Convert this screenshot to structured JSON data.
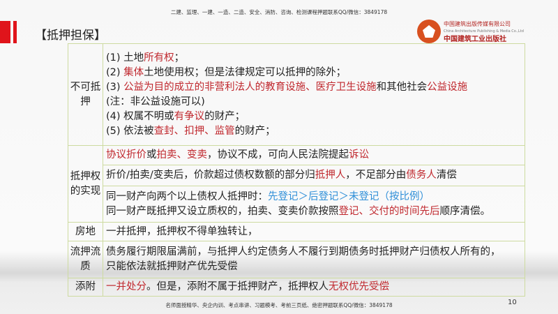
{
  "header_banner": "二建、监理、一建、一造、二造、安全、消防、咨询、检测课程押题联系QQ/微信：3849178",
  "title": "【抵押担保】",
  "logo": {
    "cn": "中国建筑出版传媒有限公司",
    "en": "China Architecture Publishing & Media Co.,Ltd",
    "cal": "中国建筑工业出版社"
  },
  "colors": {
    "red": "#c0282e",
    "blue": "#2f8fd8",
    "accent": "#e0141b"
  },
  "rows": [
    {
      "label": "不可抵押",
      "cells": [
        [
          [
            {
              "t": "(1) 土地"
            },
            {
              "t": "所有权",
              "c": "r"
            },
            {
              "t": "；"
            }
          ],
          [
            {
              "t": "(2) "
            },
            {
              "t": "集体",
              "c": "r"
            },
            {
              "t": "土地使用权；但是法律规定可以抵押的除外；"
            }
          ],
          [
            {
              "t": "(3) "
            },
            {
              "t": "公益为目的成立的非营利法人的教育设施、医疗卫生设施",
              "c": "r"
            },
            {
              "t": "和其他社会"
            },
            {
              "t": "公益设施",
              "c": "r"
            }
          ],
          [
            {
              "t": "(注：非公益设施可以)"
            }
          ],
          [
            {
              "t": "(4) 权属不明或"
            },
            {
              "t": "有争议",
              "c": "r"
            },
            {
              "t": "的财产；"
            }
          ],
          [
            {
              "t": "(5) 依法被"
            },
            {
              "t": "查封、扣押、监管",
              "c": "r"
            },
            {
              "t": "的财产；"
            }
          ]
        ]
      ]
    },
    {
      "label": "抵押权的实现",
      "cells": [
        [
          [
            {
              "t": "协议折价",
              "c": "r"
            },
            {
              "t": "或"
            },
            {
              "t": "拍卖、变卖",
              "c": "r"
            },
            {
              "t": "，协议不成，可向人民法院提起"
            },
            {
              "t": "诉讼",
              "c": "r"
            }
          ]
        ],
        [
          [
            {
              "t": "折价/拍卖/变卖后，价款超过债权数额的部分归"
            },
            {
              "t": "抵押人",
              "c": "r"
            },
            {
              "t": "，不足部分由"
            },
            {
              "t": "债务人",
              "c": "r"
            },
            {
              "t": "清偿"
            }
          ]
        ],
        [
          [
            {
              "t": "同一财产向两个以上债权人抵押时："
            },
            {
              "t": "先登记＞后登记＞未登记（按比例）",
              "c": "b"
            }
          ],
          [
            {
              "t": "同一财产既抵押又设立质权的，拍卖、变卖价款按照"
            },
            {
              "t": "登记、交付的时间先后",
              "c": "r"
            },
            {
              "t": "顺序清偿。"
            }
          ]
        ]
      ]
    },
    {
      "label": "房地",
      "cells": [
        [
          [
            {
              "t": "一并抵押，抵押权不得单独转让，"
            }
          ]
        ]
      ]
    },
    {
      "label": "流押流质",
      "cells": [
        [
          [
            {
              "t": "债务履行期限届满前，与抵押人约定债务人不履行到期债务时抵押财产归债权人所有的，"
            }
          ],
          [
            {
              "t": "只能依法就抵押财产优先受偿"
            }
          ]
        ]
      ]
    },
    {
      "label": "添附",
      "cells": [
        [
          [
            {
              "t": "一并处分",
              "c": "r"
            },
            {
              "t": "。但是，添附不属于抵押财产，抵押权人"
            },
            {
              "t": "无权优先受偿",
              "c": "r"
            }
          ]
        ]
      ]
    }
  ],
  "footer": "名师面授精华、央企内训、考点串讲、习题模考、考前三页纸、绝密押题联系QQ/微信：3849178",
  "page_number": "10"
}
